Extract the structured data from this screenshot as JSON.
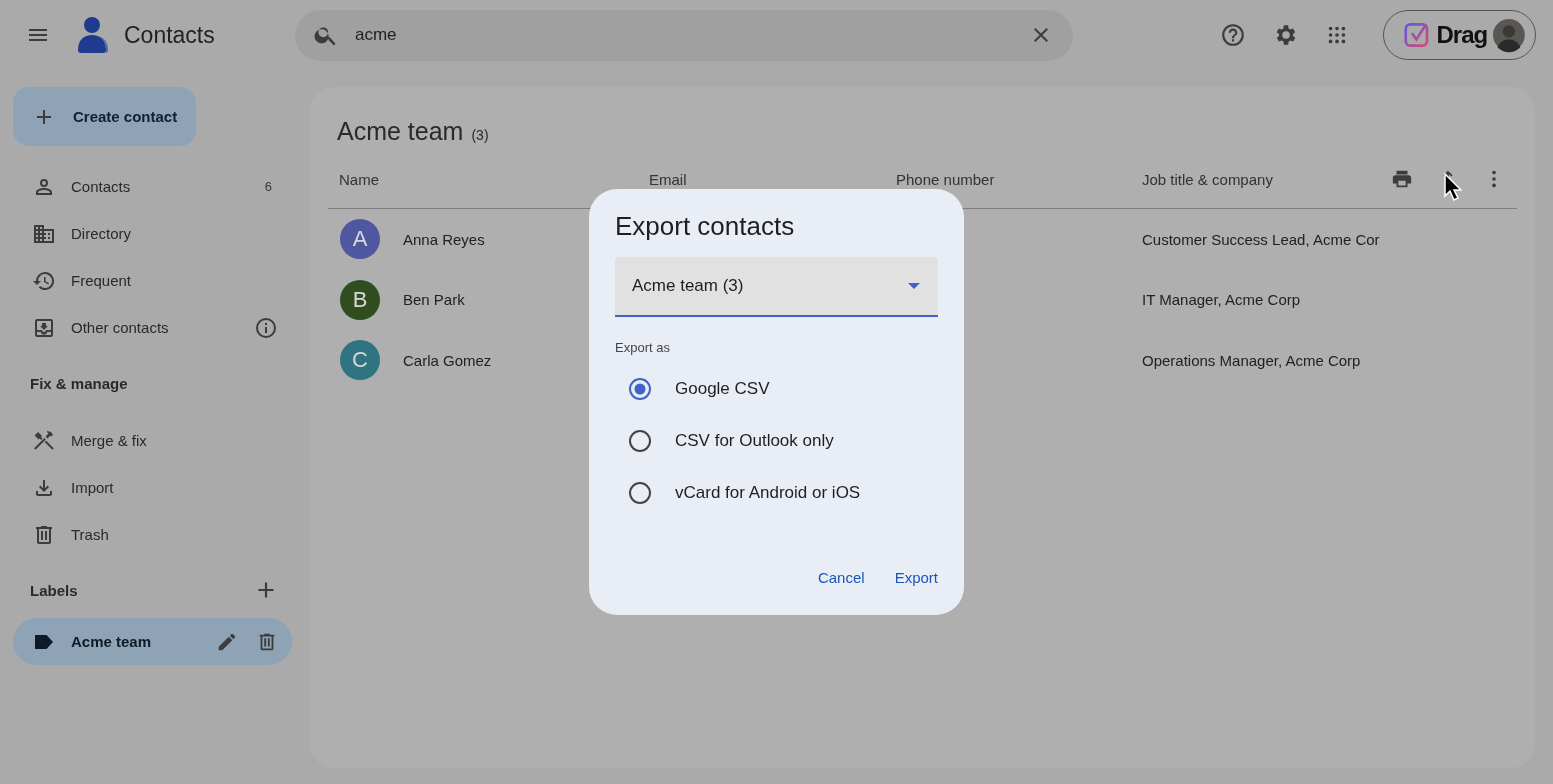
{
  "header": {
    "app_title": "Contacts",
    "search": {
      "value": "acme"
    },
    "extension": {
      "label": "Drag"
    }
  },
  "sidebar": {
    "create_button": "Create contact",
    "main_items": [
      {
        "label": "Contacts",
        "count": "6",
        "selected": false
      },
      {
        "label": "Directory",
        "selected": false
      },
      {
        "label": "Frequent",
        "selected": false
      },
      {
        "label": "Other contacts",
        "selected": false
      }
    ],
    "fix_heading": "Fix & manage",
    "fix_items": [
      {
        "label": "Merge & fix",
        "selected": false
      },
      {
        "label": "Import",
        "selected": false
      },
      {
        "label": "Trash",
        "selected": false
      }
    ],
    "labels_heading": "Labels",
    "labels": [
      {
        "label": "Acme team",
        "selected": true
      }
    ]
  },
  "list": {
    "title": "Acme team",
    "count": "(3)",
    "columns": [
      "Name",
      "Email",
      "Phone number",
      "Job title & company"
    ],
    "rows": [
      {
        "initial": "A",
        "name": "Anna Reyes",
        "job": "Customer Success Lead, Acme Cor",
        "color": "#4f57a0"
      },
      {
        "initial": "B",
        "name": "Ben Park",
        "job": "IT Manager, Acme Corp",
        "color": "#2f4d1f"
      },
      {
        "initial": "C",
        "name": "Carla Gomez",
        "job": "Operations Manager, Acme Corp",
        "color": "#2f7480"
      }
    ]
  },
  "dialog": {
    "title": "Export contacts",
    "select": {
      "value": "Acme team (3)"
    },
    "export_as_label": "Export as",
    "options": [
      {
        "label": "Google CSV",
        "selected": true
      },
      {
        "label": "CSV for Outlook only",
        "selected": false
      },
      {
        "label": "vCard for Android or iOS",
        "selected": false
      }
    ],
    "buttons": [
      "Cancel",
      "Export"
    ]
  }
}
